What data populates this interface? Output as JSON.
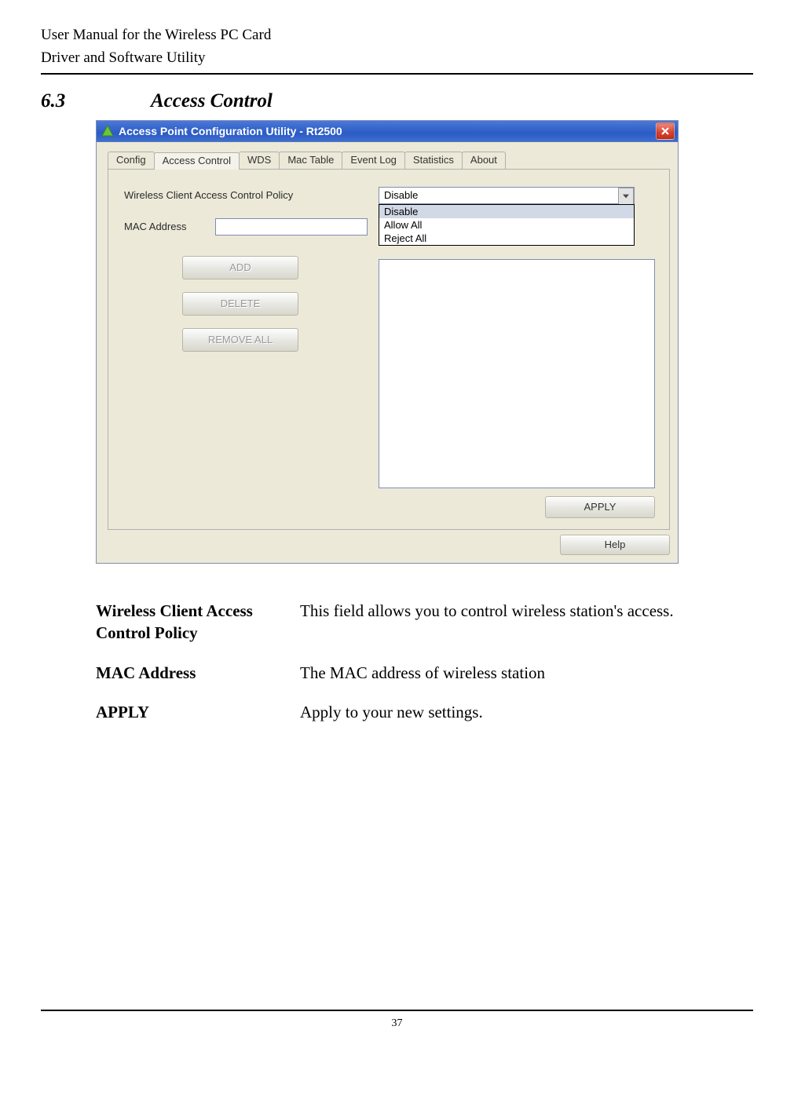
{
  "doc": {
    "header_line1": "User Manual for the Wireless PC Card",
    "header_line2": "Driver and Software Utility",
    "section_number": "6.3",
    "section_title": "Access Control",
    "page_number": "37"
  },
  "window": {
    "title": "Access Point Configuration Utility - Rt2500",
    "tabs": [
      "Config",
      "Access Control",
      "WDS",
      "Mac Table",
      "Event Log",
      "Statistics",
      "About"
    ],
    "active_tab_index": 1,
    "policy_label": "Wireless Client Access Control Policy",
    "policy_selected": "Disable",
    "policy_options": [
      "Disable",
      "Allow All",
      "Reject All"
    ],
    "mac_label": "MAC Address",
    "mac_value": "",
    "buttons": {
      "add": "ADD",
      "delete": "DELETE",
      "remove_all": "REMOVE ALL",
      "apply": "APPLY",
      "help": "Help"
    }
  },
  "descriptions": [
    {
      "term": "Wireless Client Access Control Policy",
      "def": "This field allows you to control wireless station's access."
    },
    {
      "term": "MAC Address",
      "def": "The MAC address of wireless station"
    },
    {
      "term": "APPLY",
      "def": "Apply to your new settings."
    }
  ]
}
